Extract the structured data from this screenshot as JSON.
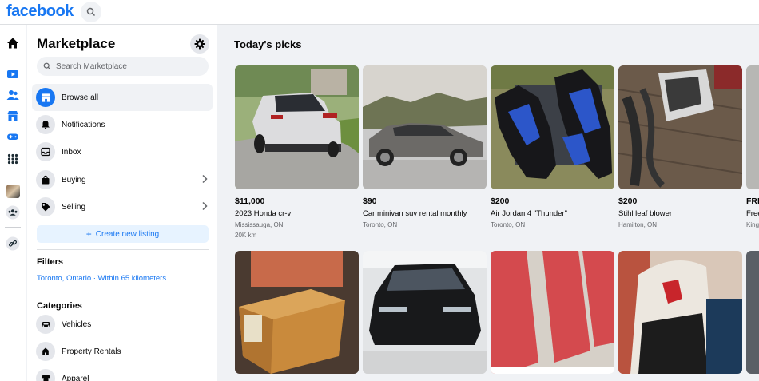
{
  "header": {
    "logo": "facebook"
  },
  "sidebar": {
    "title": "Marketplace",
    "search_placeholder": "Search Marketplace",
    "nav": [
      {
        "label": "Browse all"
      },
      {
        "label": "Notifications"
      },
      {
        "label": "Inbox"
      },
      {
        "label": "Buying"
      },
      {
        "label": "Selling"
      }
    ],
    "create_label": "Create new listing",
    "filters_heading": "Filters",
    "location": "Toronto, Ontario · Within 65 kilometers",
    "categories_heading": "Categories",
    "categories": [
      {
        "label": "Vehicles"
      },
      {
        "label": "Property Rentals"
      },
      {
        "label": "Apparel"
      }
    ]
  },
  "main": {
    "title": "Today's picks",
    "listings": [
      {
        "price": "$11,000",
        "title": "2023 Honda cr-v",
        "location": "Mississauga, ON",
        "extra": "20K km"
      },
      {
        "price": "$90",
        "title": "Car minivan suv rental monthly",
        "location": "Toronto, ON",
        "extra": ""
      },
      {
        "price": "$200",
        "title": "Air Jordan 4 \"Thunder\"",
        "location": "Toronto, ON",
        "extra": ""
      },
      {
        "price": "$200",
        "title": "Stihl leaf blower",
        "location": "Hamilton, ON",
        "extra": ""
      },
      {
        "price": "FRE",
        "title": "Free",
        "location": "King",
        "extra": ""
      }
    ]
  },
  "colors": {
    "brand": "#1877f2",
    "background": "#f0f2f5",
    "secondary_text": "#65676b"
  }
}
